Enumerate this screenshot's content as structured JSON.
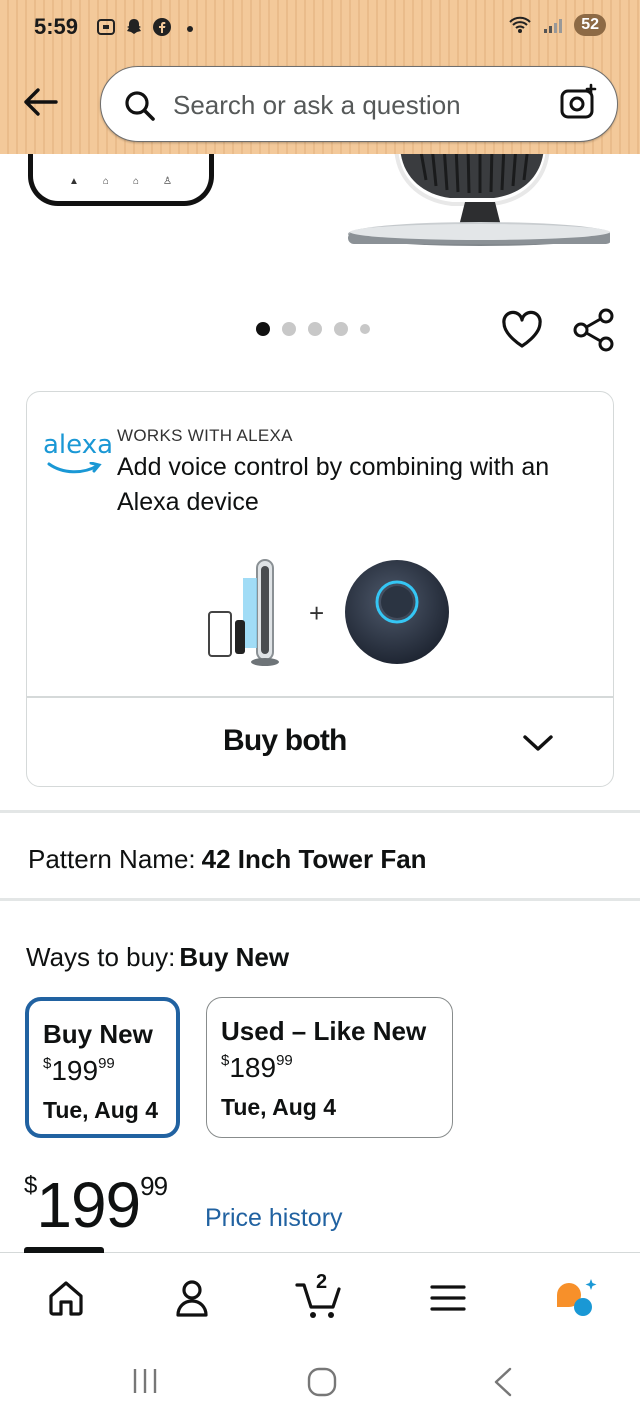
{
  "status_bar": {
    "time": "5:59",
    "battery": "52"
  },
  "search": {
    "placeholder": "Search or ask a question"
  },
  "gallery": {
    "image_count": 5,
    "active_index": 0
  },
  "alexa": {
    "logo": "alexa",
    "kicker": "WORKS WITH ALEXA",
    "description": "Add voice control by combining with an Alexa device",
    "plus": "+",
    "buy_both": "Buy both"
  },
  "pattern": {
    "label": "Pattern Name:",
    "value": "42 Inch Tower Fan"
  },
  "ways_to_buy": {
    "label": "Ways to buy:",
    "value": "Buy New",
    "options": [
      {
        "title": "Buy New",
        "currency": "$",
        "price_whole": "199",
        "price_cents": "99",
        "date": "Tue, Aug 4",
        "selected": true
      },
      {
        "title": "Used – Like New",
        "currency": "$",
        "price_whole": "189",
        "price_cents": "99",
        "date": "Tue, Aug 4",
        "selected": false
      }
    ]
  },
  "price": {
    "currency": "$",
    "whole": "199",
    "cents": "99",
    "history_link": "Price history"
  },
  "bottom_nav": {
    "cart_count": "2",
    "items": [
      "home-icon",
      "account-icon",
      "cart-icon",
      "menu-icon",
      "rufus-icon"
    ]
  },
  "colors": {
    "header_bg": "#f3c99a",
    "link_blue": "#2162a1",
    "alexa_blue": "#1a98d5",
    "assistant_orange": "#f7902a"
  }
}
